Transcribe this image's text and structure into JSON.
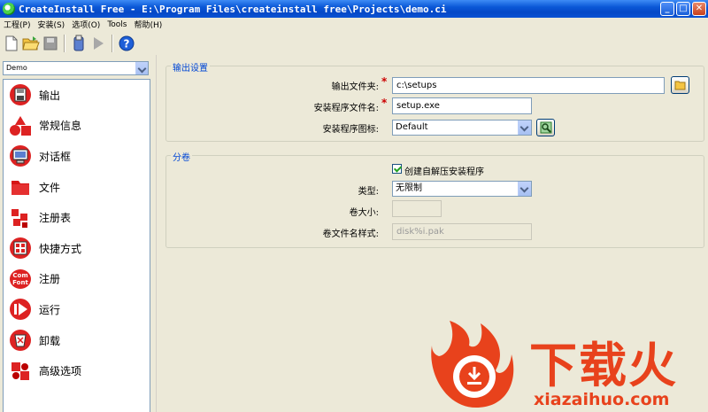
{
  "window": {
    "title": "CreateInstall Free - E:\\Program Files\\createinstall free\\Projects\\demo.ci"
  },
  "menu": [
    "工程(P)",
    "安装(S)",
    "选项(O)",
    "Tools",
    "帮助(H)"
  ],
  "toolbar": {
    "icons": [
      "new-file-icon",
      "open-folder-icon",
      "save-icon",
      "build-icon",
      "run-icon",
      "help-icon"
    ]
  },
  "project_select": {
    "value": "Demo"
  },
  "sidebar": {
    "items": [
      {
        "label": "输出",
        "icon": "disk-icon"
      },
      {
        "label": "常规信息",
        "icon": "shapes-icon"
      },
      {
        "label": "对话框",
        "icon": "monitor-icon"
      },
      {
        "label": "文件",
        "icon": "folder-icon"
      },
      {
        "label": "注册表",
        "icon": "registry-icon"
      },
      {
        "label": "快捷方式",
        "icon": "shortcut-icon"
      },
      {
        "label": "注册",
        "icon": "com-font-icon"
      },
      {
        "label": "运行",
        "icon": "run-icon"
      },
      {
        "label": "卸载",
        "icon": "recycle-bin-icon"
      },
      {
        "label": "高级选项",
        "icon": "puzzle-icon"
      }
    ]
  },
  "output_settings": {
    "title": "输出设置",
    "output_folder_label": "输出文件夹:",
    "output_folder_value": "c:\\setups",
    "setup_filename_label": "安装程序文件名:",
    "setup_filename_value": "setup.exe",
    "setup_icon_label": "安装程序图标:",
    "setup_icon_value": "Default"
  },
  "volumes": {
    "title": "分卷",
    "sfx_checkbox_label": "创建自解压安装程序",
    "sfx_checked": true,
    "type_label": "类型:",
    "type_value": "无限制",
    "volume_size_label": "卷大小:",
    "volume_size_value": "",
    "volume_name_label": "卷文件名样式:",
    "volume_name_value": "disk%i.pak"
  },
  "watermark": {
    "brand": "下载火",
    "url": "xiazaihuo.com"
  },
  "colors": {
    "titlebar": "#0a57d6",
    "group_title": "#0046d5",
    "required": "#cc0000",
    "brand": "#e8421c"
  }
}
